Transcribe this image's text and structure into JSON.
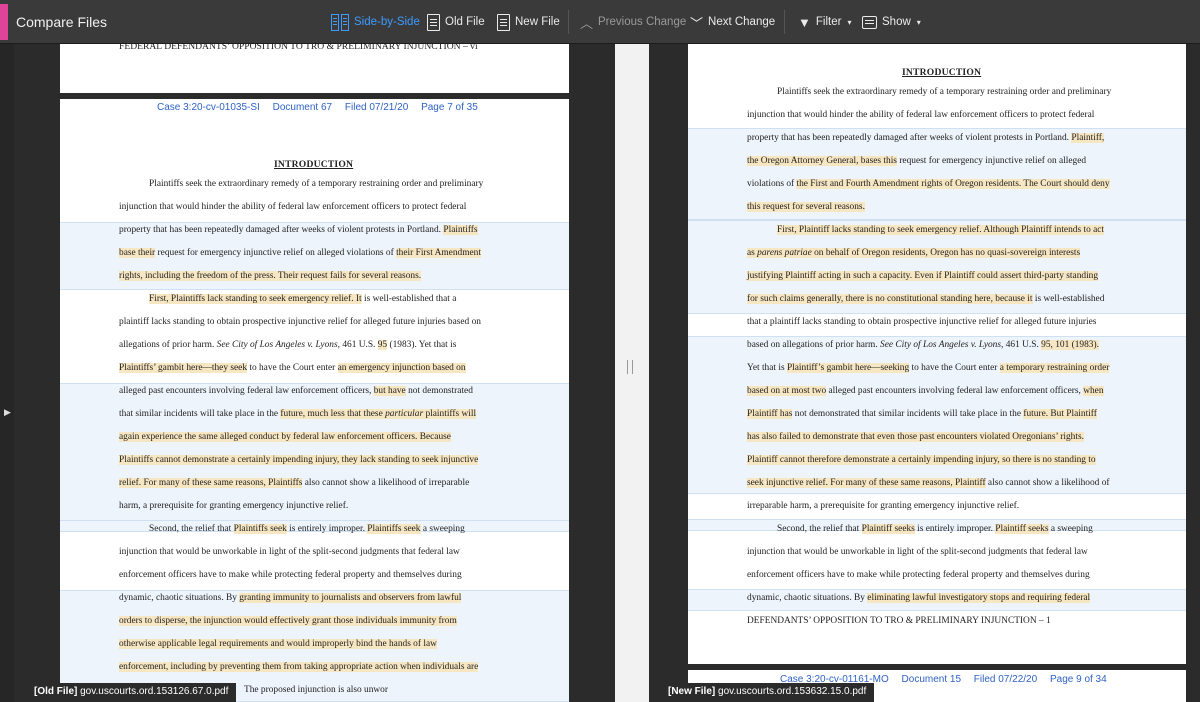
{
  "toolbar": {
    "title": "Compare Files",
    "side_by_side": "Side-by-Side",
    "old_file": "Old File",
    "new_file": "New File",
    "previous_change": "Previous Change",
    "next_change": "Next Change",
    "filter": "Filter",
    "show": "Show",
    "accent_color": "#e0449a",
    "active_color": "#3d9bff"
  },
  "left": {
    "top_footer": "FEDERAL DEFENDANTS’ OPPOSITION TO TRO & PRELIMINARY INJUNCTION – vi",
    "header": {
      "case": "Case 3:20-cv-01035-SI",
      "document": "Document 67",
      "filed": "Filed 07/21/20",
      "page": "Page 7 of 35"
    },
    "heading": "INTRODUCTION",
    "file_tag": "[Old File]",
    "file_name": "gov.uscourts.ord.153126.67.0.pdf",
    "cut_tail": "The proposed injunction is also unwor"
  },
  "right": {
    "heading": "INTRODUCTION",
    "footer": "DEFENDANTS’ OPPOSITION TO TRO & PRELIMINARY INJUNCTION – 1",
    "header": {
      "case": "Case 3:20-cv-01161-MO",
      "document": "Document 15",
      "filed": "Filed 07/22/20",
      "page": "Page 9 of 34"
    },
    "file_tag": "[New File]",
    "file_name": "gov.uscourts.ord.153632.15.0.pdf"
  }
}
